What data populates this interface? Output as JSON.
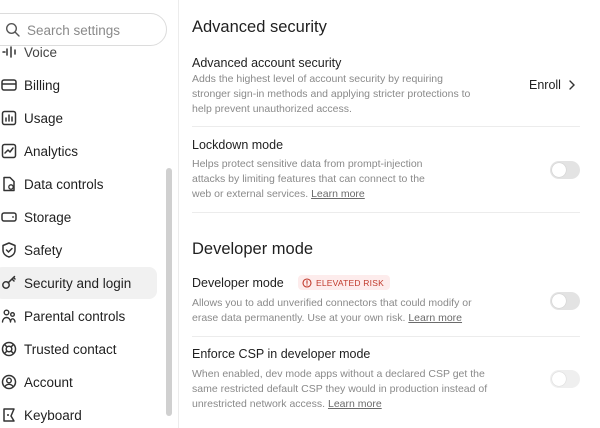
{
  "sidebar": {
    "search_placeholder": "Search settings",
    "items": [
      {
        "label": "Voice",
        "icon": "voice-icon",
        "partial": true
      },
      {
        "label": "Billing",
        "icon": "billing-icon"
      },
      {
        "label": "Usage",
        "icon": "usage-icon"
      },
      {
        "label": "Analytics",
        "icon": "analytics-icon"
      },
      {
        "label": "Data controls",
        "icon": "data-controls-icon"
      },
      {
        "label": "Storage",
        "icon": "storage-icon"
      },
      {
        "label": "Safety",
        "icon": "safety-icon"
      },
      {
        "label": "Security and login",
        "icon": "security-icon",
        "active": true
      },
      {
        "label": "Parental controls",
        "icon": "parental-icon"
      },
      {
        "label": "Trusted contact",
        "icon": "lifebuoy-icon"
      },
      {
        "label": "Account",
        "icon": "account-icon"
      },
      {
        "label": "Keyboard",
        "icon": "keyboard-icon"
      }
    ]
  },
  "main": {
    "advanced_security": {
      "title": "Advanced security",
      "row": {
        "title": "Advanced account security",
        "description": "Adds the highest level of account security by requiring stronger sign-in methods and applying stricter protections to help prevent unauthorized access.",
        "action_label": "Enroll"
      },
      "lockdown": {
        "title": "Lockdown mode",
        "description": "Helps protect sensitive data from prompt-injection attacks by limiting features that can connect to the web or external services.",
        "link": "Learn more",
        "enabled": false
      }
    },
    "developer_mode": {
      "title": "Developer mode",
      "row": {
        "title": "Developer mode",
        "badge": "ELEVATED RISK",
        "description": "Allows you to add unverified connectors that could modify or erase data permanently. Use at your own risk.",
        "link": "Learn more",
        "enabled": false
      },
      "csp": {
        "title": "Enforce CSP in developer mode",
        "description": "When enabled, dev mode apps without a declared CSP get the same restricted default CSP they would in production instead of unrestricted network access.",
        "link": "Learn more",
        "enabled": false,
        "disabled": true
      }
    }
  },
  "colors": {
    "active_item_bg": "#f1f1f1",
    "risk_text": "#c0392b",
    "risk_bg": "#fdecec",
    "toggle_off": "#e3e3e3",
    "muted_text": "#8a8a8a"
  }
}
